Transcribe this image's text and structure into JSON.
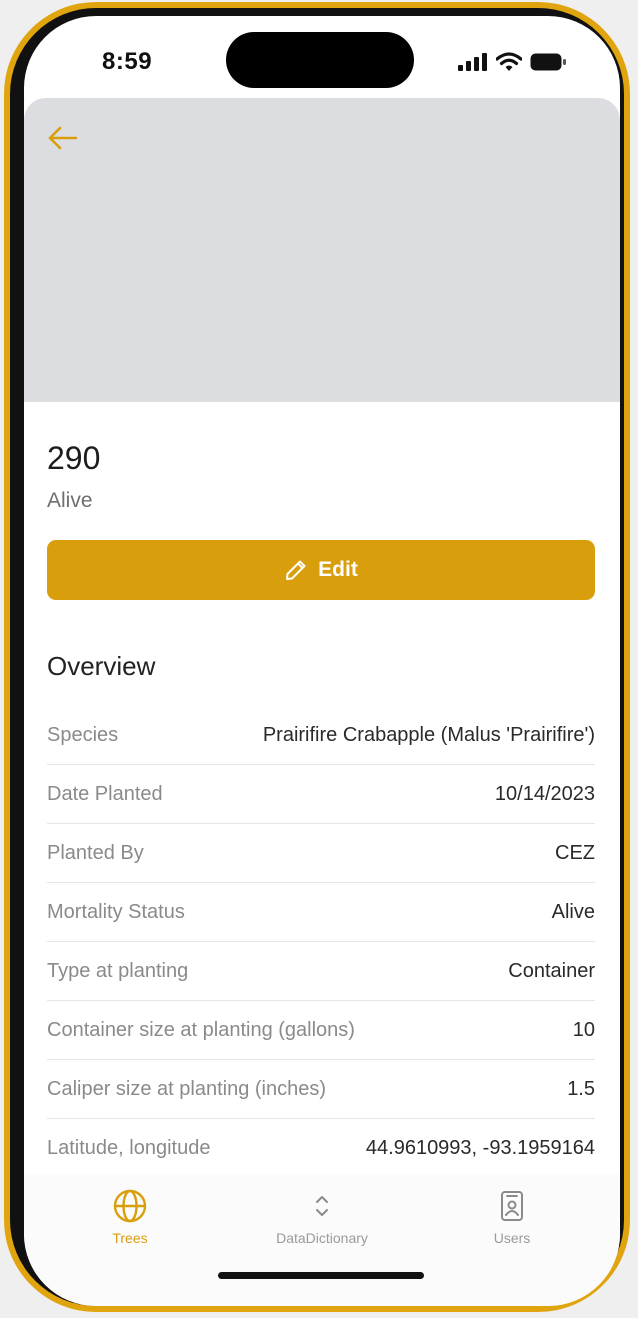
{
  "status_bar": {
    "time": "8:59"
  },
  "header": {
    "back_icon": "arrow-left-icon"
  },
  "tree": {
    "id": "290",
    "status": "Alive"
  },
  "edit_button": {
    "label": "Edit",
    "icon": "pencil-icon"
  },
  "overview": {
    "title": "Overview",
    "rows": [
      {
        "label": "Species",
        "value": "Prairifire Crabapple (Malus 'Prairifire')"
      },
      {
        "label": "Date Planted",
        "value": "10/14/2023"
      },
      {
        "label": "Planted By",
        "value": "CEZ"
      },
      {
        "label": "Mortality Status",
        "value": "Alive"
      },
      {
        "label": "Type at planting",
        "value": "Container"
      },
      {
        "label": "Container size at planting (gallons)",
        "value": "10"
      },
      {
        "label": "Caliper size at planting (inches)",
        "value": "1.5"
      },
      {
        "label": "Latitude, longitude",
        "value": "44.9610993, -93.1959164"
      }
    ]
  },
  "tabbar": {
    "tabs": [
      {
        "label": "Trees",
        "icon": "globe-icon",
        "active": true
      },
      {
        "label": "DataDictionary",
        "icon": "chevron-up-down-icon",
        "active": false
      },
      {
        "label": "Users",
        "icon": "user-badge-icon",
        "active": false
      }
    ]
  },
  "colors": {
    "accent": "#d99e0b",
    "hero_background": "#dcdde1",
    "label_gray": "#8a8a8a"
  }
}
